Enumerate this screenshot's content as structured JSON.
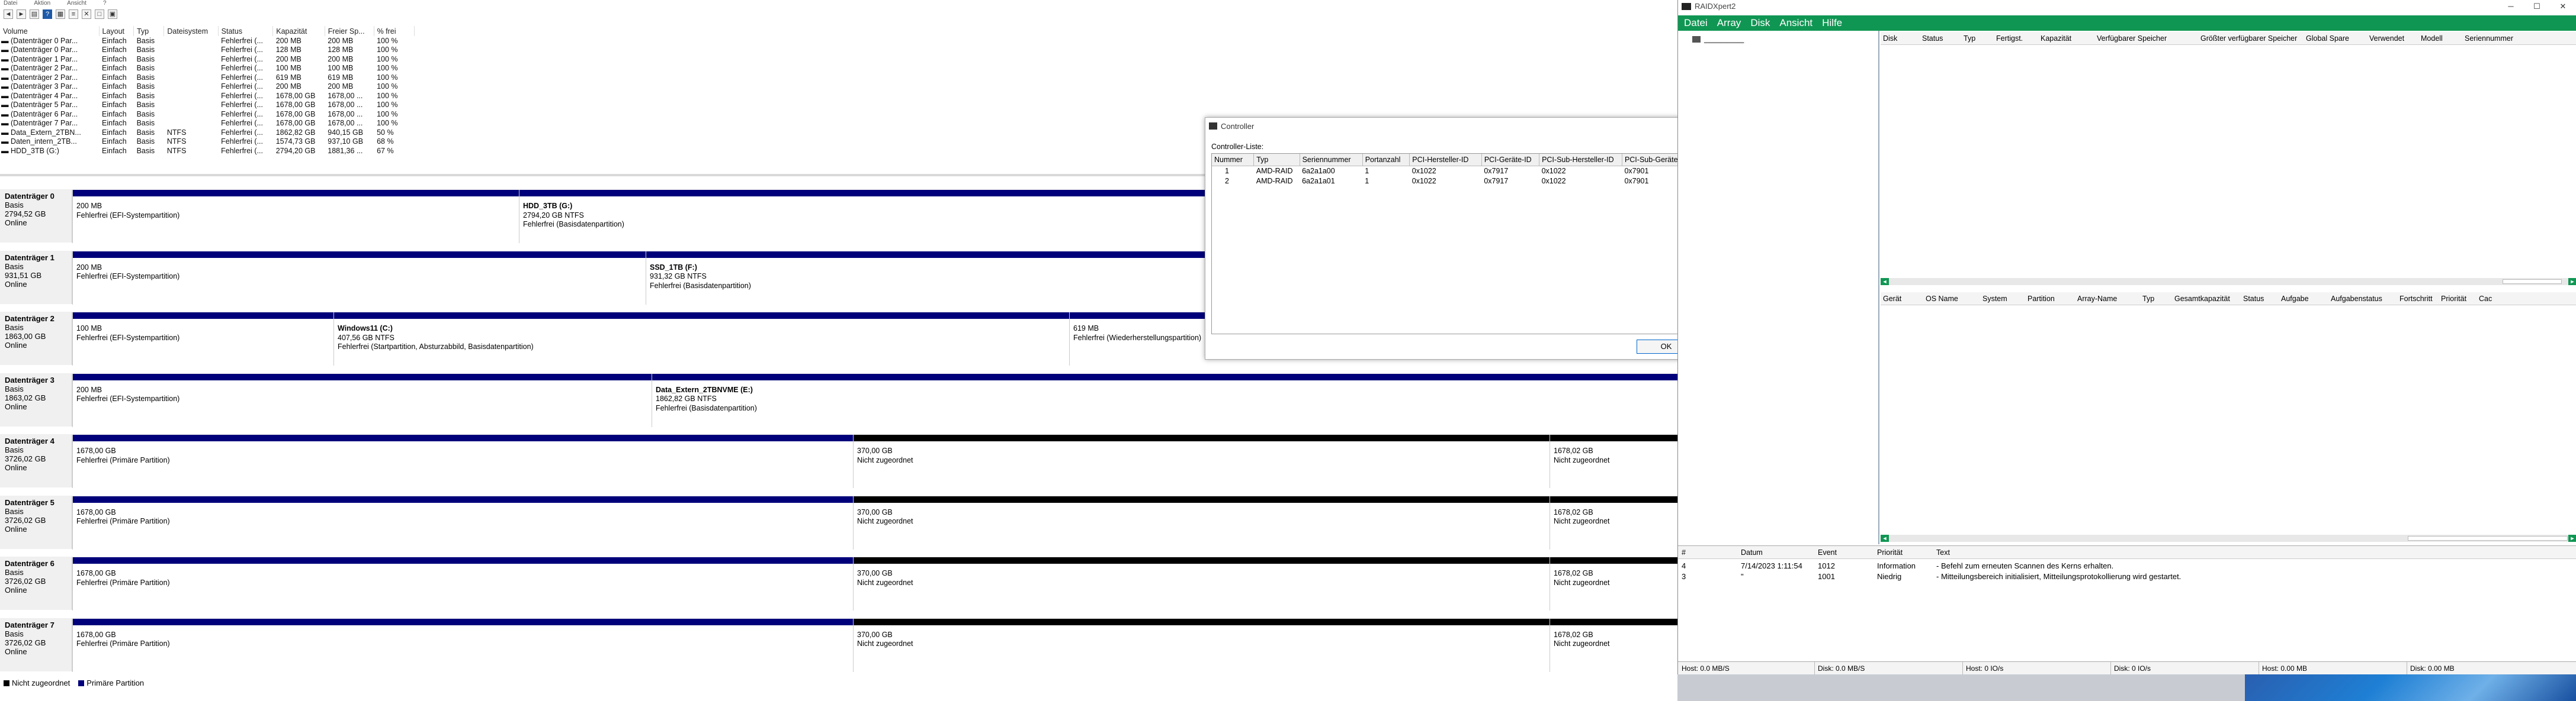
{
  "dm": {
    "menu": [
      "Datei",
      "Aktion",
      "Ansicht",
      "?"
    ],
    "columns": [
      "Volume",
      "Layout",
      "Typ",
      "Dateisystem",
      "Status",
      "Kapazität",
      "Freier Sp...",
      "% frei"
    ],
    "volumes": [
      [
        "(Datenträger 0 Par...",
        "Einfach",
        "Basis",
        "",
        "Fehlerfrei (...",
        "200 MB",
        "200 MB",
        "100 %"
      ],
      [
        "(Datenträger 0 Par...",
        "Einfach",
        "Basis",
        "",
        "Fehlerfrei (...",
        "128 MB",
        "128 MB",
        "100 %"
      ],
      [
        "(Datenträger 1 Par...",
        "Einfach",
        "Basis",
        "",
        "Fehlerfrei (...",
        "200 MB",
        "200 MB",
        "100 %"
      ],
      [
        "(Datenträger 2 Par...",
        "Einfach",
        "Basis",
        "",
        "Fehlerfrei (...",
        "100 MB",
        "100 MB",
        "100 %"
      ],
      [
        "(Datenträger 2 Par...",
        "Einfach",
        "Basis",
        "",
        "Fehlerfrei (...",
        "619 MB",
        "619 MB",
        "100 %"
      ],
      [
        "(Datenträger 3 Par...",
        "Einfach",
        "Basis",
        "",
        "Fehlerfrei (...",
        "200 MB",
        "200 MB",
        "100 %"
      ],
      [
        "(Datenträger 4 Par...",
        "Einfach",
        "Basis",
        "",
        "Fehlerfrei (...",
        "1678,00 GB",
        "1678,00 ...",
        "100 %"
      ],
      [
        "(Datenträger 5 Par...",
        "Einfach",
        "Basis",
        "",
        "Fehlerfrei (...",
        "1678,00 GB",
        "1678,00 ...",
        "100 %"
      ],
      [
        "(Datenträger 6 Par...",
        "Einfach",
        "Basis",
        "",
        "Fehlerfrei (...",
        "1678,00 GB",
        "1678,00 ...",
        "100 %"
      ],
      [
        "(Datenträger 7 Par...",
        "Einfach",
        "Basis",
        "",
        "Fehlerfrei (...",
        "1678,00 GB",
        "1678,00 ...",
        "100 %"
      ],
      [
        "Data_Extern_2TBN...",
        "Einfach",
        "Basis",
        "NTFS",
        "Fehlerfrei (...",
        "1862,82 GB",
        "940,15 GB",
        "50 %"
      ],
      [
        "Daten_intern_2TB...",
        "Einfach",
        "Basis",
        "NTFS",
        "Fehlerfrei (...",
        "1574,73 GB",
        "937,10 GB",
        "68 %"
      ],
      [
        "HDD_3TB (G:)",
        "Einfach",
        "Basis",
        "NTFS",
        "Fehlerfrei (...",
        "2794,20 GB",
        "1881,36 ...",
        "67 %"
      ]
    ],
    "disks": [
      {
        "title": "Datenträger 0",
        "type": "Basis",
        "size": "2794,52 GB",
        "status": "Online",
        "parts": [
          {
            "name": "",
            "line1": "200 MB",
            "line2": "Fehlerfrei (EFI-Systempartition)",
            "kind": "prim"
          },
          {
            "name": "HDD_3TB  (G:)",
            "line1": "2794,20 GB NTFS",
            "line2": "Fehlerfrei (Basisdatenpartition)",
            "kind": "prim"
          }
        ]
      },
      {
        "title": "Datenträger 1",
        "type": "Basis",
        "size": "931,51 GB",
        "status": "Online",
        "parts": [
          {
            "name": "",
            "line1": "200 MB",
            "line2": "Fehlerfrei (EFI-Systempartition)",
            "kind": "prim"
          },
          {
            "name": "SSD_1TB  (F:)",
            "line1": "931,32 GB NTFS",
            "line2": "Fehlerfrei (Basisdatenpartition)",
            "kind": "prim"
          }
        ]
      },
      {
        "title": "Datenträger 2",
        "type": "Basis",
        "size": "1863,00 GB",
        "status": "Online",
        "parts": [
          {
            "name": "",
            "line1": "100 MB",
            "line2": "Fehlerfrei (EFI-Systempartition)",
            "kind": "prim"
          },
          {
            "name": "Windows11  (C:)",
            "line1": "407,56 GB NTFS",
            "line2": "Fehlerfrei (Startpartition, Absturzabbild, Basisdatenpartition)",
            "kind": "prim"
          },
          {
            "name": "",
            "line1": "619 MB",
            "line2": "Fehlerfrei (Wiederherstellungspartition)",
            "kind": "prim"
          }
        ]
      },
      {
        "title": "Datenträger 3",
        "type": "Basis",
        "size": "1863,02 GB",
        "status": "Online",
        "parts": [
          {
            "name": "",
            "line1": "200 MB",
            "line2": "Fehlerfrei (EFI-Systempartition)",
            "kind": "prim"
          },
          {
            "name": "Data_Extern_2TBNVME  (E:)",
            "line1": "1862,82 GB NTFS",
            "line2": "Fehlerfrei (Basisdatenpartition)",
            "kind": "prim"
          }
        ]
      },
      {
        "title": "Datenträger 4",
        "type": "Basis",
        "size": "3726,02 GB",
        "status": "Online",
        "parts": [
          {
            "name": "",
            "line1": "1678,00 GB",
            "line2": "Fehlerfrei (Primäre Partition)",
            "kind": "prim"
          },
          {
            "name": "",
            "line1": "370,00 GB",
            "line2": "Nicht zugeordnet",
            "kind": "unal"
          },
          {
            "name": "",
            "line1": "1678,02 GB",
            "line2": "Nicht zugeordnet",
            "kind": "unal"
          }
        ]
      },
      {
        "title": "Datenträger 5",
        "type": "Basis",
        "size": "3726,02 GB",
        "status": "Online",
        "parts": [
          {
            "name": "",
            "line1": "1678,00 GB",
            "line2": "Fehlerfrei (Primäre Partition)",
            "kind": "prim"
          },
          {
            "name": "",
            "line1": "370,00 GB",
            "line2": "Nicht zugeordnet",
            "kind": "unal"
          },
          {
            "name": "",
            "line1": "1678,02 GB",
            "line2": "Nicht zugeordnet",
            "kind": "unal"
          }
        ]
      },
      {
        "title": "Datenträger 6",
        "type": "Basis",
        "size": "3726,02 GB",
        "status": "Online",
        "parts": [
          {
            "name": "",
            "line1": "1678,00 GB",
            "line2": "Fehlerfrei (Primäre Partition)",
            "kind": "prim"
          },
          {
            "name": "",
            "line1": "370,00 GB",
            "line2": "Nicht zugeordnet",
            "kind": "unal"
          },
          {
            "name": "",
            "line1": "1678,02 GB",
            "line2": "Nicht zugeordnet",
            "kind": "unal"
          }
        ]
      },
      {
        "title": "Datenträger 7",
        "type": "Basis",
        "size": "3726,02 GB",
        "status": "Online",
        "parts": [
          {
            "name": "",
            "line1": "1678,00 GB",
            "line2": "Fehlerfrei (Primäre Partition)",
            "kind": "prim"
          },
          {
            "name": "",
            "line1": "370,00 GB",
            "line2": "Nicht zugeordnet",
            "kind": "unal"
          },
          {
            "name": "",
            "line1": "1678,02 GB",
            "line2": "Nicht zugeordnet",
            "kind": "unal"
          }
        ]
      }
    ],
    "legend": {
      "unallocated": "Nicht zugeordnet",
      "primary": "Primäre Partition"
    },
    "colors": {
      "primary": "#00007a",
      "unallocated": "#000000"
    }
  },
  "controller": {
    "title": "Controller",
    "label": "Controller-Liste:",
    "columns": [
      "Nummer",
      "Typ",
      "Seriennummer",
      "Portanzahl",
      "PCI-Hersteller-ID",
      "PCI-Geräte-ID",
      "PCI-Sub-Hersteller-ID",
      "PCI-Sub-Geräte-ID"
    ],
    "rows": [
      [
        "1",
        "AMD-RAID",
        "6a2a1a00",
        "1",
        "0x1022",
        "0x7917",
        "0x1022",
        "0x7901"
      ],
      [
        "2",
        "AMD-RAID",
        "6a2a1a01",
        "1",
        "0x1022",
        "0x7917",
        "0x1022",
        "0x7901"
      ]
    ],
    "ok": "OK"
  },
  "rx": {
    "title": "RAIDXpert2",
    "menu": [
      "Datei",
      "Array",
      "Disk",
      "Ansicht",
      "Hilfe"
    ],
    "disk_columns": [
      "Disk",
      "Status",
      "Typ",
      "Fertigst.",
      "Kapazität",
      "Verfügbarer Speicher",
      "Größter verfügbarer Speicher",
      "Global Spare",
      "Verwendet",
      "Modell",
      "Seriennummer"
    ],
    "array_columns": [
      "Gerät",
      "OS Name",
      "System",
      "Partition",
      "Array-Name",
      "Typ",
      "Gesamtkapazität",
      "Status",
      "Aufgabe",
      "Aufgabenstatus",
      "Fortschritt",
      "Priorität",
      "Cac"
    ],
    "event_columns": [
      "#",
      "Datum",
      "Event",
      "Priorität",
      "Text"
    ],
    "events": [
      [
        "4",
        "7/14/2023 1:11:54",
        "1012",
        "Information",
        "- Befehl zum erneuten Scannen des Kerns erhalten."
      ],
      [
        "3",
        "\"",
        "1001",
        "Niedrig",
        "- Mitteilungsbereich initialisiert, Mitteilungsprotokollierung wird gestartet."
      ]
    ],
    "status": [
      "Host: 0.0 MB/S",
      "Disk: 0.0 MB/S",
      "Host: 0 IO/s",
      "Disk: 0 IO/s",
      "Host: 0.00 MB",
      "Disk: 0.00 MB"
    ],
    "accent": "#109653"
  }
}
